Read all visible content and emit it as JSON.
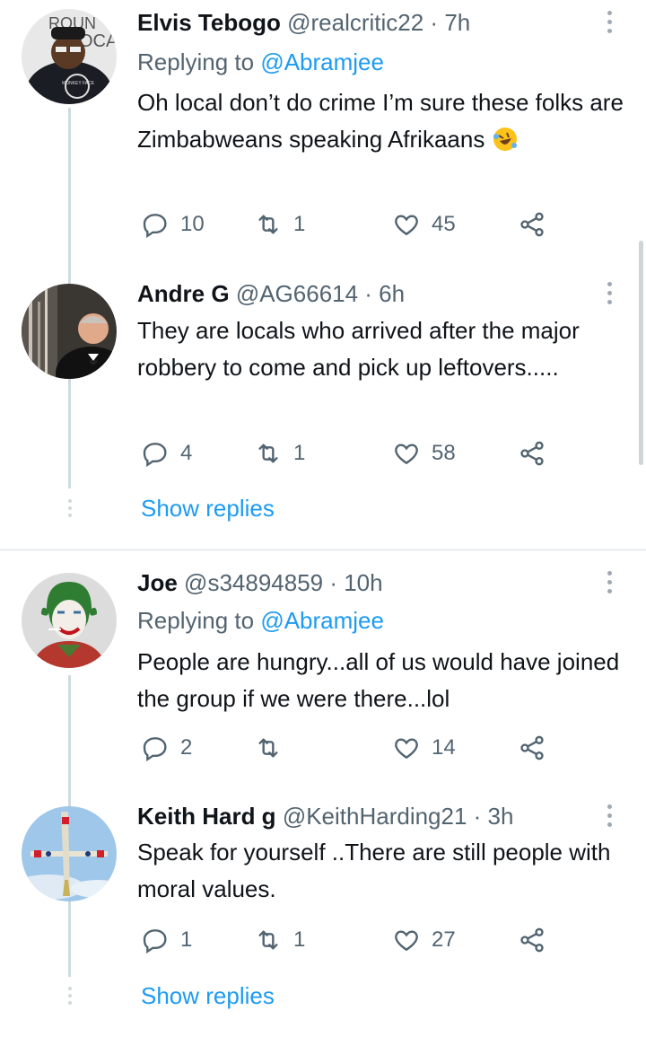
{
  "tweets": [
    {
      "name": "Elvis Tebogo",
      "handle": "@realcritic22 · 7h",
      "replying_prefix": "Replying to",
      "replying_to": "@Abramjee",
      "body": "Oh local don’t do crime I’m sure these folks are Zimbabweans speaking Afrikaans",
      "emoji": "rolling-on-floor-laughing",
      "replies": "10",
      "retweets": "1",
      "likes": "45",
      "avatar_text_top": "ROUN",
      "avatar_text_mid": "OCA",
      "avatar_text_badge": "MONKEY FACE"
    },
    {
      "name": "Andre G",
      "handle": "@AG66614 · 6h",
      "body": "They are locals who arrived after the major robbery to come and pick up leftovers.....",
      "replies": "4",
      "retweets": "1",
      "likes": "58"
    },
    {
      "name": "Joe",
      "handle": "@s34894859 · 10h",
      "replying_prefix": "Replying to",
      "replying_to": "@Abramjee",
      "body": "People are hungry...all of us would have joined the group if we were there...lol",
      "replies": "2",
      "retweets": "",
      "likes": "14"
    },
    {
      "name": "Keith Hard g",
      "handle": "@KeithHarding21 · 3h",
      "body": "Speak for yourself ..There are still people with moral values.",
      "replies": "1",
      "retweets": "1",
      "likes": "27"
    }
  ],
  "show_replies_label": "Show replies",
  "colors": {
    "link": "#1d9bf0",
    "muted": "#536471",
    "text": "#0f1419",
    "thread_line": "#cfd9de"
  },
  "icons": [
    "reply-icon",
    "retweet-icon",
    "like-icon",
    "share-icon",
    "more-options-icon"
  ]
}
